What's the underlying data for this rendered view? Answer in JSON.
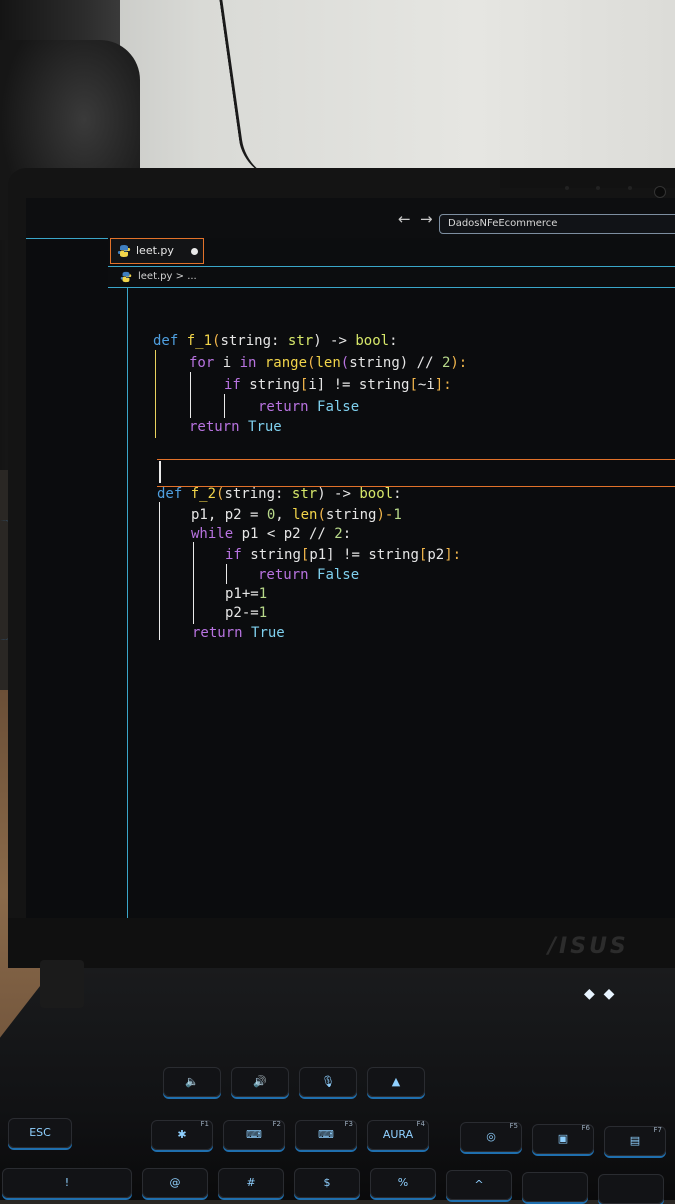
{
  "scene": "photo of a laptop screen showing a code editor",
  "editor": {
    "search_box": "DadosNFeEcommerce",
    "tab_label": "leet.py",
    "breadcrumb_file": "leet.py",
    "breadcrumb_sep": "> ..."
  },
  "code": {
    "f1": {
      "l1": [
        "def ",
        "f_1",
        "(",
        "string",
        ": ",
        "str",
        ") -> ",
        "bool",
        ":"
      ],
      "l2": [
        "for ",
        "i ",
        "in ",
        "range",
        "(",
        "len",
        "(",
        "string",
        ") // ",
        "2",
        "):"
      ],
      "l3": [
        "if ",
        "string",
        "[",
        "i",
        "] != ",
        "string",
        "[",
        "~i",
        "]:"
      ],
      "l4": [
        "return ",
        "False"
      ],
      "l5": [
        "return ",
        "True"
      ]
    },
    "f2": {
      "l1": [
        "def ",
        "f_2",
        "(",
        "string",
        ": ",
        "str",
        ") -> ",
        "bool",
        ":"
      ],
      "l2": [
        "p1, p2 = ",
        "0",
        ", ",
        "len",
        "(",
        "string",
        ")-",
        "1"
      ],
      "l3": [
        "while ",
        "p1 < p2 // ",
        "2",
        ":"
      ],
      "l4": [
        "if ",
        "string",
        "[",
        "p1",
        "] != ",
        "string",
        "[",
        "p2",
        "]:"
      ],
      "l5": [
        "return ",
        "False"
      ],
      "l6": [
        "p1+=",
        "1"
      ],
      "l7": [
        "p2-=",
        "1"
      ],
      "l8": [
        "return ",
        "True"
      ]
    }
  },
  "keyboard": {
    "brand": "/ISUS",
    "esc": "ESC",
    "aura": "AURA",
    "f1": "F1",
    "f2": "F2",
    "f3": "F3",
    "f4": "F4",
    "f5": "F5",
    "f6": "F6",
    "f7": "F7",
    "num_row": [
      "!",
      "@",
      "#",
      "$",
      "%",
      "^"
    ]
  },
  "colors": {
    "accent_blue": "#3aa6c9",
    "accent_orange": "#e2722a",
    "keyword": "#4f9fdf",
    "function": "#f2d54a",
    "control": "#b873e0"
  }
}
